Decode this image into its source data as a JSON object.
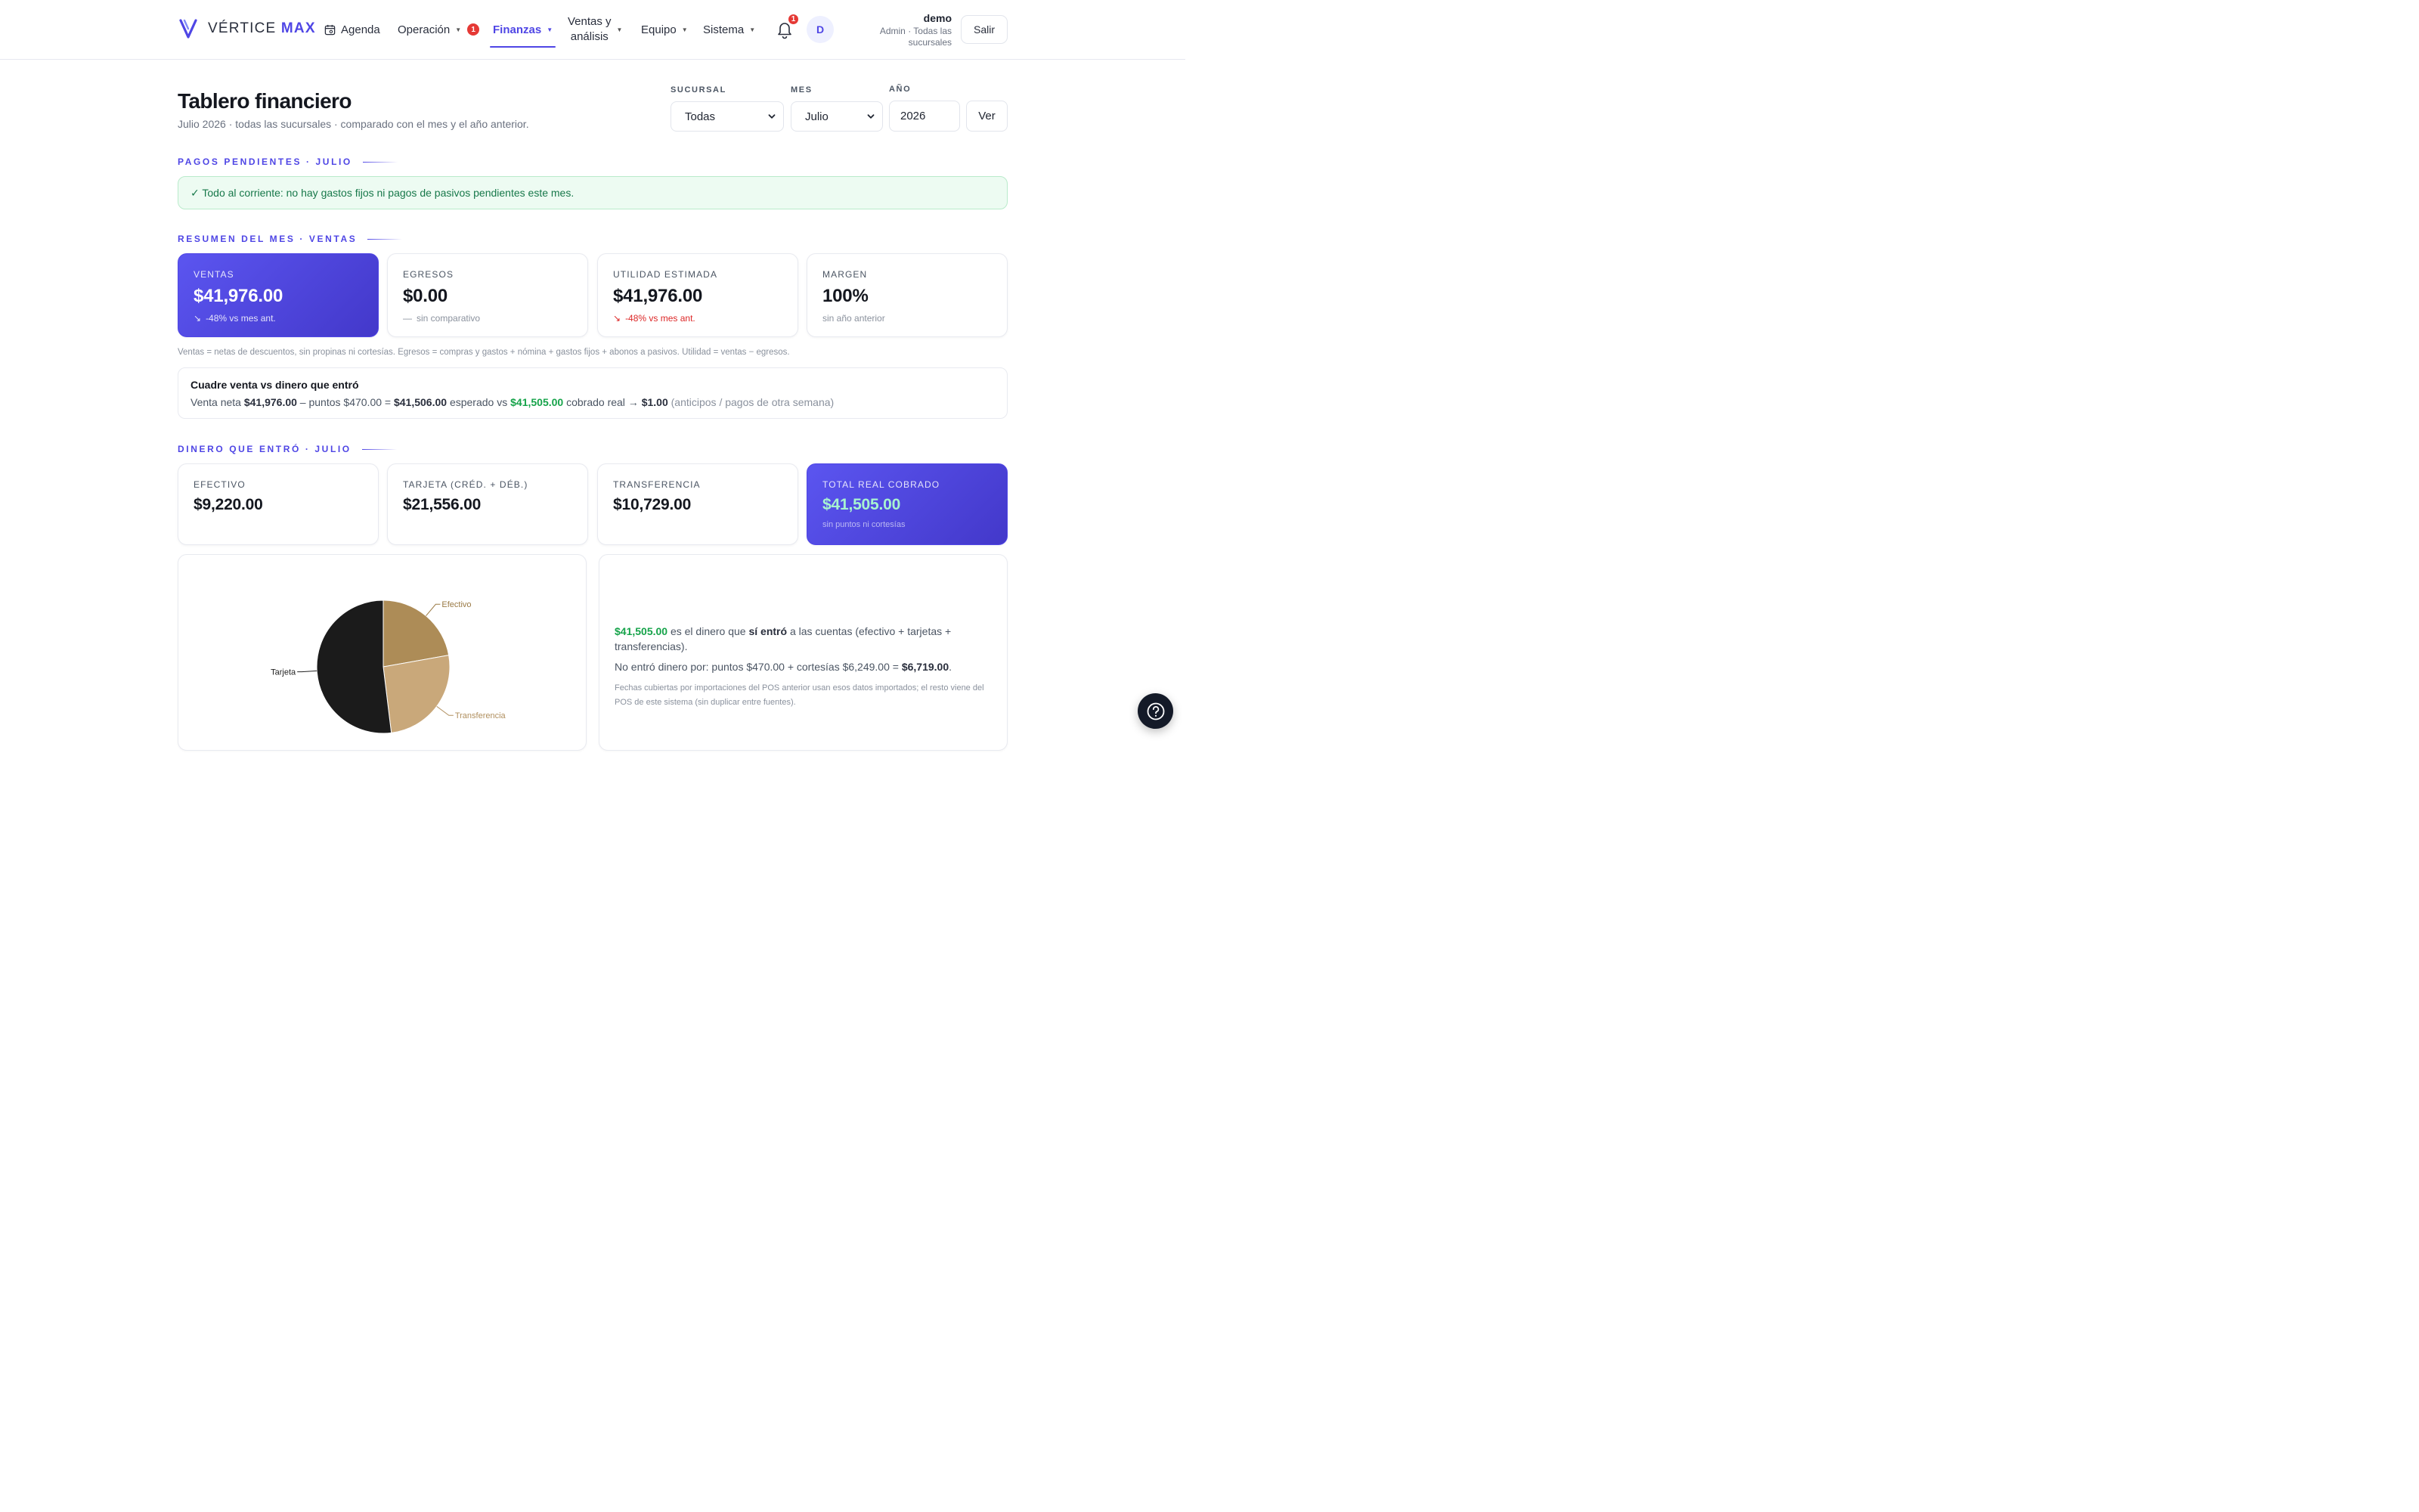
{
  "brand": {
    "name": "VÉRTICE",
    "suffix": "MAX"
  },
  "nav": {
    "agenda": "Agenda",
    "operacion": "Operación",
    "operacion_badge": "1",
    "finanzas": "Finanzas",
    "ventas_line1": "Ventas y",
    "ventas_line2": "análisis",
    "equipo": "Equipo",
    "sistema": "Sistema",
    "notifications_badge": "1"
  },
  "user": {
    "initial": "D",
    "name": "demo",
    "role": "Admin · Todas las sucursales",
    "logout": "Salir"
  },
  "page": {
    "title": "Tablero financiero",
    "subtitle": "Julio 2026 · todas las sucursales · comparado con el mes y el año anterior."
  },
  "filters": {
    "sucursal_label": "SUCURSAL",
    "sucursal_value": "Todas",
    "mes_label": "MES",
    "mes_value": "Julio",
    "anio_label": "AÑO",
    "anio_value": "2026",
    "submit": "Ver"
  },
  "pending": {
    "title": "PAGOS PENDIENTES · JULIO",
    "message": "✓ Todo al corriente: no hay gastos fijos ni pagos de pasivos pendientes este mes."
  },
  "summary": {
    "title": "RESUMEN DEL MES · VENTAS",
    "cards": [
      {
        "label": "VENTAS",
        "value": "$41,976.00",
        "note_icon": "↘",
        "note": "-48% vs mes ant."
      },
      {
        "label": "EGRESOS",
        "value": "$0.00",
        "note_icon": "—",
        "note": "sin comparativo"
      },
      {
        "label": "UTILIDAD ESTIMADA",
        "value": "$41,976.00",
        "note_icon": "↘",
        "note": "-48% vs mes ant."
      },
      {
        "label": "MARGEN",
        "value": "100%",
        "note": "sin año anterior"
      }
    ],
    "footnote": "Ventas = netas de descuentos, sin propinas ni cortesías. Egresos = compras y gastos + nómina + gastos fijos + abonos a pasivos. Utilidad = ventas − egresos."
  },
  "reconcile": {
    "title": "Cuadre venta vs dinero que entró",
    "p1": "Venta neta ",
    "venta_neta": "$41,976.00",
    "p2": " – puntos $470.00 = ",
    "esperado": "$41,506.00",
    "p3": " esperado vs ",
    "cobrado": "$41,505.00",
    "p4": " cobrado real → ",
    "diferencia": "$1.00",
    "p5": " (anticipos / pagos de otra semana)"
  },
  "income": {
    "title": "DINERO QUE ENTRÓ · JULIO",
    "cards": [
      {
        "label": "EFECTIVO",
        "value": "$9,220.00"
      },
      {
        "label": "TARJETA (CRÉD. + DÉB.)",
        "value": "$21,556.00"
      },
      {
        "label": "TRANSFERENCIA",
        "value": "$10,729.00"
      },
      {
        "label": "TOTAL REAL COBRADO",
        "value": "$41,505.00",
        "note": "sin puntos ni cortesías"
      }
    ]
  },
  "chart_data": {
    "type": "pie",
    "categories": [
      "Efectivo",
      "Transferencia",
      "Tarjeta"
    ],
    "values": [
      9220,
      10729,
      21556
    ],
    "colors": [
      "#ad8c57",
      "#c9a87a",
      "#1b1b1b"
    ],
    "label_colors": [
      "#9a7a45",
      "#b08f5e",
      "#222222"
    ],
    "title": "",
    "legend": "none"
  },
  "info": {
    "amount": "$41,505.00",
    "p1": " es el dinero que ",
    "p1b": "sí entró",
    "p1c": " a las cuentas (efectivo + tarjetas + transferencias).",
    "p2": "No entró dinero por: puntos $470.00 + cortesías $6,249.00 = ",
    "p2b": "$6,719.00",
    "p2c": ".",
    "small": "Fechas cubiertas por importaciones del POS anterior usan esos datos importados; el resto viene del POS de este sistema (sin duplicar entre fuentes)."
  },
  "icons": {
    "calendar": "calendar-icon",
    "bell": "bell-icon",
    "help": "help-icon",
    "chevron": "chevron-down-icon"
  },
  "colors": {
    "accent": "#4f46e5",
    "success": "#16a34a",
    "danger": "#dc2626"
  }
}
